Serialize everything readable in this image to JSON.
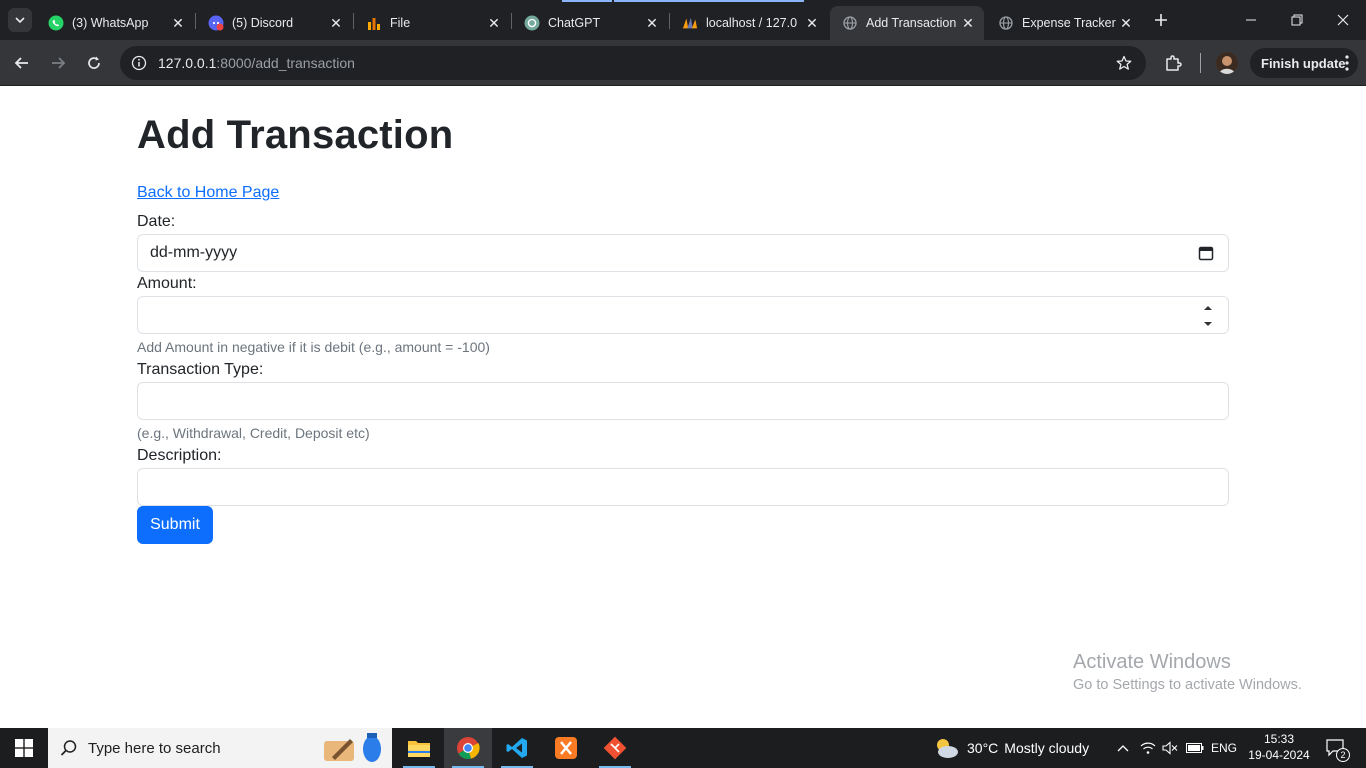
{
  "browser": {
    "tabs": [
      {
        "title": "(3) WhatsApp"
      },
      {
        "title": "(5) Discord"
      },
      {
        "title": "File"
      },
      {
        "title": "ChatGPT"
      },
      {
        "title": "localhost / 127.0"
      },
      {
        "title": "Add Transaction",
        "active": true
      },
      {
        "title": "Expense Tracker"
      }
    ],
    "url_host": "127.0.0.1",
    "url_rest": ":8000/add_transaction",
    "finish_update_label": "Finish update"
  },
  "page": {
    "title": "Add Transaction",
    "back_link": "Back to Home Page",
    "form": {
      "date_label": "Date:",
      "date_placeholder": "dd-mm-yyyy",
      "amount_label": "Amount:",
      "amount_value": "",
      "amount_help": "Add Amount in negative if it is debit (e.g., amount = -100)",
      "type_label": "Transaction Type:",
      "type_value": "",
      "type_help": "(e.g., Withdrawal, Credit, Deposit etc)",
      "description_label": "Description:",
      "description_value": "",
      "submit_label": "Submit"
    }
  },
  "watermark": {
    "line1": "Activate Windows",
    "line2": "Go to Settings to activate Windows."
  },
  "taskbar": {
    "search_placeholder": "Type here to search",
    "weather": {
      "temp": "30°C",
      "condition": "Mostly cloudy"
    },
    "language": "ENG",
    "time": "15:33",
    "date": "19-04-2024",
    "notification_count": "2"
  },
  "colors": {
    "primary": "#0d6efd",
    "text": "#212529",
    "muted": "#6c757d",
    "chrome_dark": "#202124",
    "chrome_toolbar": "#35363a"
  }
}
